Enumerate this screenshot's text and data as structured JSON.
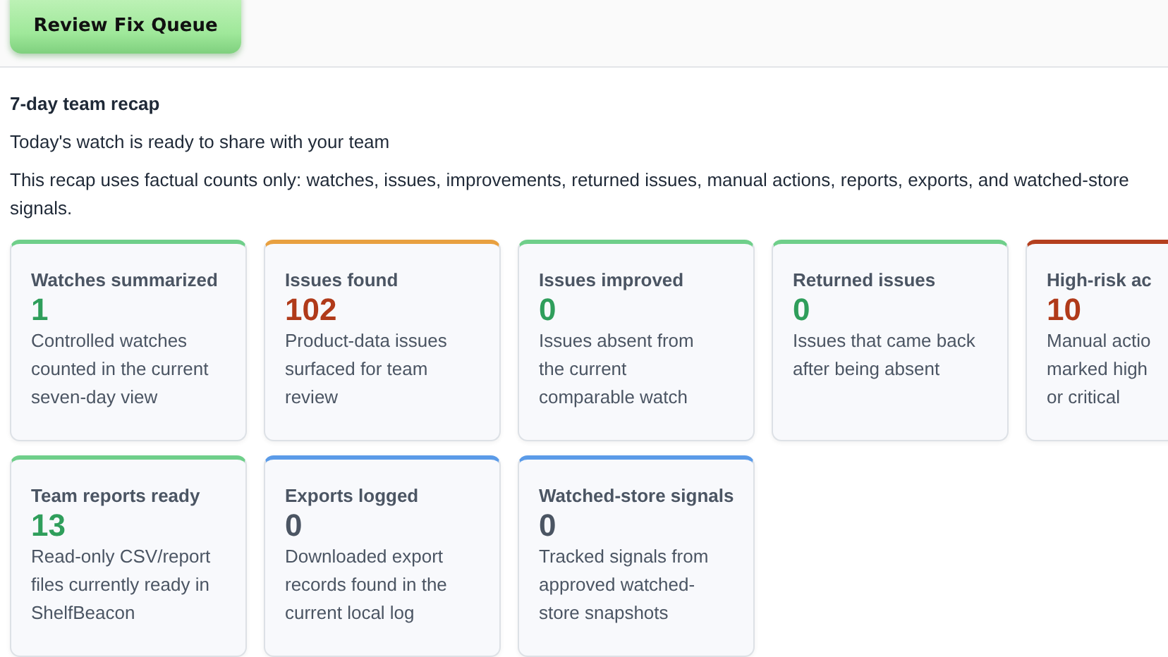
{
  "toolbar": {
    "button": "Review Fix Queue"
  },
  "recap": {
    "title": "7-day team recap",
    "subtitle": "Today's watch is ready to share with your team",
    "note": "This recap uses factual counts only: watches, issues, improvements, returned issues, manual actions, reports, exports, and watched-store signals."
  },
  "cards": [
    {
      "kind": "good",
      "title": "Watches summarized",
      "value": "1",
      "lines": [
        "Controlled watches",
        "counted in the current",
        "seven-day view"
      ]
    },
    {
      "kind": "warn",
      "title": "Issues found",
      "value": "102",
      "lines": [
        "Product-data issues",
        "surfaced for team",
        "review"
      ]
    },
    {
      "kind": "good",
      "title": "Issues improved",
      "value": "0",
      "lines": [
        "Issues absent from",
        "the current",
        "comparable watch"
      ]
    },
    {
      "kind": "good",
      "title": "Returned issues",
      "value": "0",
      "lines": [
        "Issues that came back",
        "after being absent"
      ]
    },
    {
      "kind": "alert",
      "title": "High-risk ac",
      "value": "10",
      "lines": [
        "Manual actio",
        "marked high",
        "or critical"
      ]
    },
    {
      "kind": "good",
      "title": "Team reports ready",
      "value": "13",
      "lines": [
        "Read-only CSV/report",
        "files currently ready in",
        "ShelfBeacon"
      ]
    },
    {
      "kind": "info",
      "title": "Exports logged",
      "value": "0",
      "lines": [
        "Downloaded export",
        "records found in the",
        "current local log"
      ]
    },
    {
      "kind": "info",
      "title": "Watched-store signals",
      "value": "0",
      "lines": [
        "Tracked signals from",
        "approved watched-",
        "store snapshots"
      ]
    }
  ]
}
